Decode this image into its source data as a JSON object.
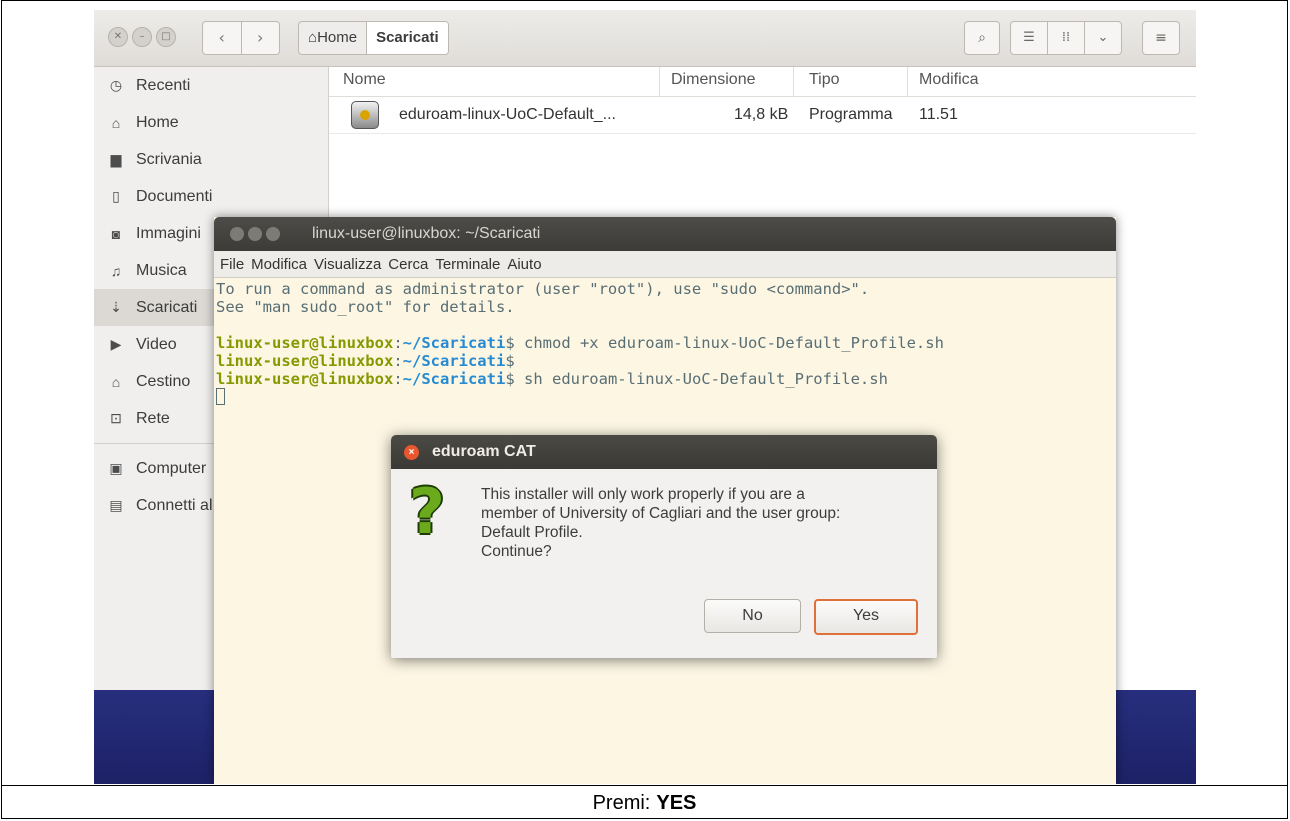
{
  "file_manager": {
    "breadcrumbs": [
      "Home",
      "Scaricati"
    ],
    "sidebar": [
      {
        "label": "Recenti",
        "icon": "clock-icon"
      },
      {
        "label": "Home",
        "icon": "home-icon"
      },
      {
        "label": "Scrivania",
        "icon": "folder-icon"
      },
      {
        "label": "Documenti",
        "icon": "document-icon"
      },
      {
        "label": "Immagini",
        "icon": "camera-icon"
      },
      {
        "label": "Musica",
        "icon": "music-icon"
      },
      {
        "label": "Scaricati",
        "icon": "download-icon"
      },
      {
        "label": "Video",
        "icon": "video-icon"
      },
      {
        "label": "Cestino",
        "icon": "trash-icon"
      },
      {
        "label": "Rete",
        "icon": "network-icon"
      },
      {
        "label": "Computer",
        "icon": "computer-icon"
      },
      {
        "label": "Connetti al server",
        "icon": "server-icon"
      }
    ],
    "columns": {
      "name": "Nome",
      "size": "Dimensione",
      "type": "Tipo",
      "modified": "Modifica"
    },
    "files": [
      {
        "name": "eduroam-linux-UoC-Default_...",
        "size": "14,8 kB",
        "type": "Programma",
        "modified": "11.51"
      }
    ]
  },
  "terminal": {
    "title": "linux-user@linuxbox: ~/Scaricati",
    "menu": [
      "File",
      "Modifica",
      "Visualizza",
      "Cerca",
      "Terminale",
      "Aiuto"
    ],
    "intro": [
      "To run a command as administrator (user \"root\"), use \"sudo <command>\".",
      "See \"man sudo_root\" for details."
    ],
    "prompt_user": "linux-user@linuxbox",
    "prompt_sep": ":",
    "prompt_path": "~/Scaricati",
    "prompt_end": "$",
    "commands": [
      " chmod +x eduroam-linux-UoC-Default_Profile.sh",
      "",
      " sh eduroam-linux-UoC-Default_Profile.sh"
    ]
  },
  "dialog": {
    "title": "eduroam CAT",
    "message": [
      "This installer will only work properly if you are a",
      "member of University of Cagliari and the user group:",
      "Default Profile.",
      "Continue?"
    ],
    "no_label": "No",
    "yes_label": "Yes"
  },
  "caption": {
    "prefix": "Premi:",
    "highlight": "YES"
  }
}
